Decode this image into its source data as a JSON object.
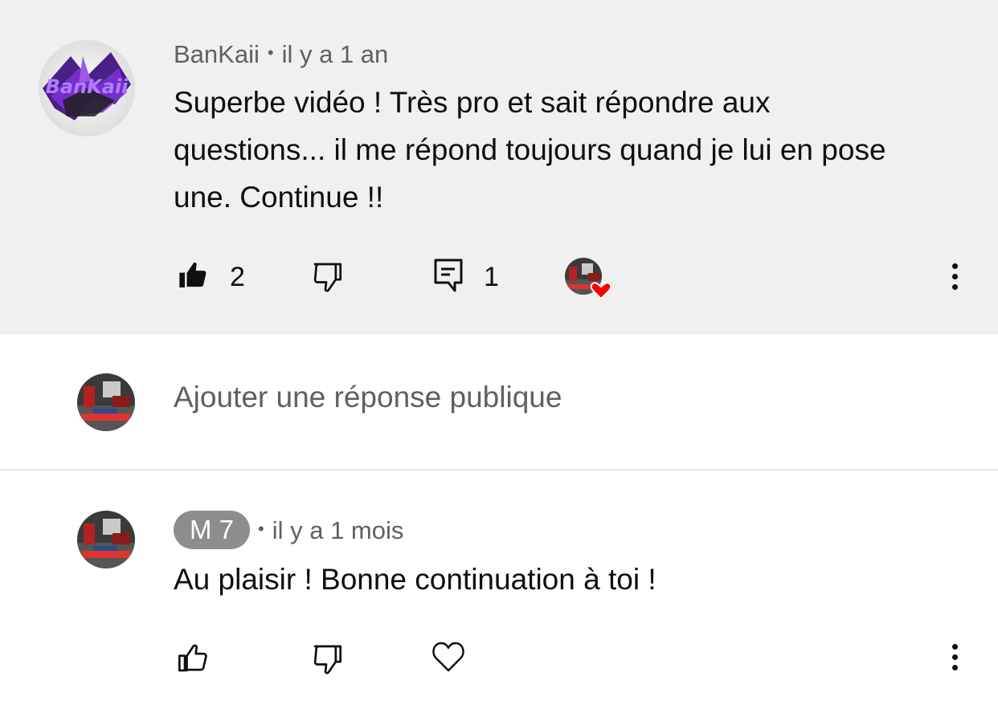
{
  "comment": {
    "author": "BanKaii",
    "separator": "•",
    "time": "il y a 1 an",
    "text": "Superbe vidéo ! Très pro et sait répondre aux questions... il me répond toujours quand je lui en pose une. Continue !!",
    "like_count": "2",
    "reply_count": "1",
    "icons": {
      "like": "thumbs-up-filled-icon",
      "dislike": "thumbs-down-icon",
      "reply": "comment-icon",
      "heart": "creator-heart-icon",
      "more": "more-vertical-icon"
    },
    "avatar_text": "BanKaii"
  },
  "reply_box": {
    "placeholder": "Ajouter une réponse publique"
  },
  "reply": {
    "author": "M 7",
    "separator": "•",
    "time": "il y a 1 mois",
    "text": "Au plaisir ! Bonne continuation à toi !",
    "icons": {
      "like": "thumbs-up-icon",
      "dislike": "thumbs-down-icon",
      "heart": "heart-outline-icon",
      "more": "more-vertical-icon"
    }
  },
  "colors": {
    "highlight_bg": "#f0f0f0",
    "secondary_text": "#606060",
    "heart_red": "#ff0000",
    "author_chip_bg": "#8d8d8d"
  }
}
